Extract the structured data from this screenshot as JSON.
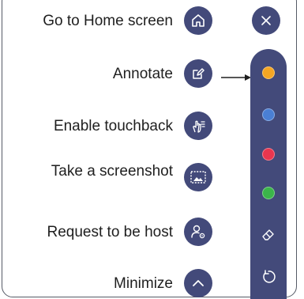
{
  "menu": {
    "items": [
      {
        "label": "Go to Home screen",
        "icon": "home-icon"
      },
      {
        "label": "Annotate",
        "icon": "annotate-icon"
      },
      {
        "label": "Enable touchback",
        "icon": "touch-hand-icon"
      },
      {
        "label": "Take a screenshot",
        "icon": "screenshot-icon"
      },
      {
        "label": "Request to be host",
        "icon": "request-host-icon"
      },
      {
        "label": "Minimize",
        "icon": "chevron-up-icon"
      }
    ]
  },
  "close": {
    "icon": "close-icon"
  },
  "palette": {
    "colors": [
      {
        "name": "orange",
        "hex": "#f5a623"
      },
      {
        "name": "blue",
        "hex": "#4a7fd4"
      },
      {
        "name": "red",
        "hex": "#e8364f"
      },
      {
        "name": "green",
        "hex": "#3bb54a"
      }
    ],
    "tools": [
      {
        "icon": "eraser-icon"
      },
      {
        "icon": "undo-icon"
      }
    ]
  },
  "colors": {
    "button_bg": "#434a7a",
    "text": "#1f1f1f",
    "border": "#555a66"
  }
}
